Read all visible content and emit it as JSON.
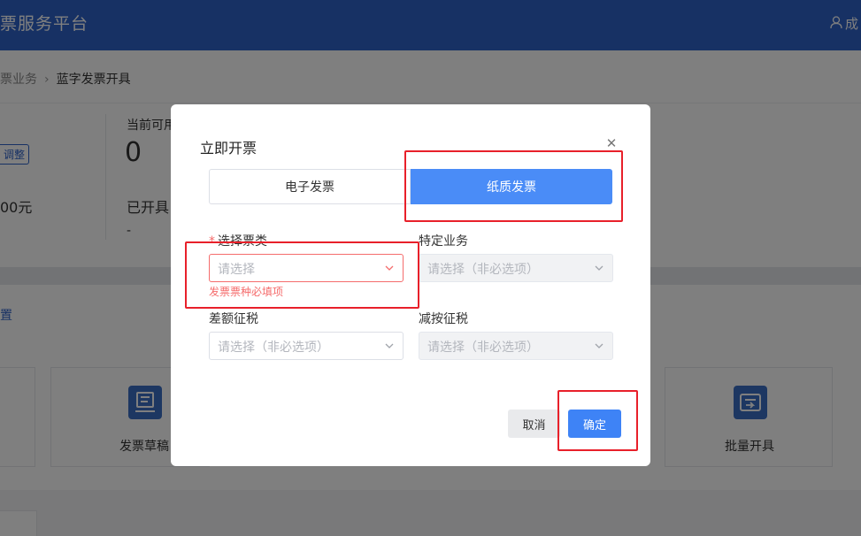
{
  "header": {
    "title": "票服务平台",
    "user_label": "成"
  },
  "breadcrumb": {
    "parent": "票业务",
    "current": "蓝字发票开具"
  },
  "stats": {
    "adjust_button": "调整",
    "amount": "00元",
    "available_label": "当前可用",
    "available_value": "0",
    "issued_label": "已开具",
    "issued_value": "-"
  },
  "tools": {
    "settings_link": "置",
    "cards": [
      {
        "label": "发票草稿",
        "icon": "draft-invoice-icon"
      },
      {
        "label": "批量开具",
        "icon": "batch-issue-icon"
      }
    ]
  },
  "dialog": {
    "title": "立即开票",
    "close_icon": "close-icon",
    "tabs": [
      {
        "label": "电子发票",
        "active": false
      },
      {
        "label": "纸质发票",
        "active": true
      }
    ],
    "fields": {
      "ticket_type": {
        "label": "选择票类",
        "required": true,
        "placeholder": "请选择",
        "error": "发票票种必填项"
      },
      "special_business": {
        "label": "特定业务",
        "placeholder": "请选择（非必选项）",
        "disabled": true
      },
      "difference_tax": {
        "label": "差额征税",
        "placeholder": "请选择（非必选项）",
        "disabled": false
      },
      "reduced_tax": {
        "label": "减按征税",
        "placeholder": "请选择（非必选项）",
        "disabled": true
      }
    },
    "cancel_label": "取消",
    "confirm_label": "确定"
  },
  "colors": {
    "header_bg": "#2f63c9",
    "primary": "#4a8cf7",
    "error": "#f56c6c",
    "highlight": "#e8202a"
  }
}
